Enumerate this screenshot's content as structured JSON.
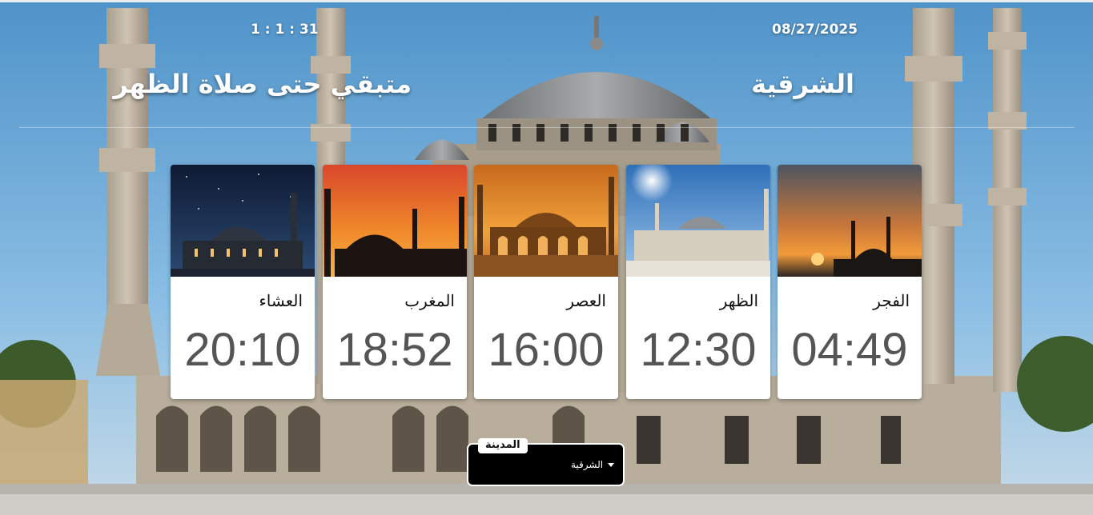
{
  "header": {
    "date": "08/27/2025",
    "countdown_timer": "1 : 1 : 31",
    "city_title": "الشرقية",
    "countdown_label": "متبقي حتى صلاة الظهر"
  },
  "prayers": [
    {
      "name": "العشاء",
      "time": "20:10",
      "scene": "night-mosque"
    },
    {
      "name": "المغرب",
      "time": "18:52",
      "scene": "sunset-silhouette"
    },
    {
      "name": "العصر",
      "time": "16:00",
      "scene": "afternoon-glow"
    },
    {
      "name": "الظهر",
      "time": "12:30",
      "scene": "midday-sun"
    },
    {
      "name": "الفجر",
      "time": "04:49",
      "scene": "dawn-silhouette"
    }
  ],
  "city_select": {
    "label": "المدينة",
    "value": "الشرقية"
  },
  "colors": {
    "sky": "#6ea8d6",
    "card_bg": "#ffffff",
    "time_text": "#555555",
    "select_bg": "#000000"
  }
}
